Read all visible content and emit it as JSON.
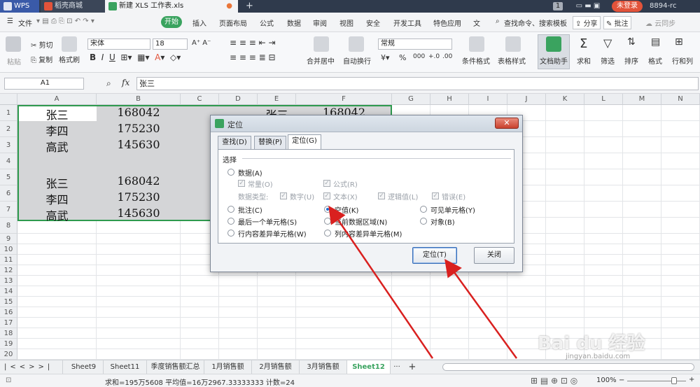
{
  "titlebar": {
    "wps": "WPS",
    "tab_store": "稻壳商城",
    "tab_file": "新建 XLS 工作表.xls",
    "badge": "1",
    "login": "未登录",
    "user_id": "8894-rc"
  },
  "menu": {
    "file": "文件",
    "items": [
      "开始",
      "插入",
      "页面布局",
      "公式",
      "数据",
      "审阅",
      "视图",
      "安全",
      "开发工具",
      "特色应用",
      "文"
    ],
    "search": "查找命令、搜索模板",
    "share": "分享",
    "comment": "批注",
    "cloud": "云同步"
  },
  "ribbon": {
    "paste": "粘贴",
    "cut": "剪切",
    "copy": "复制",
    "format_painter": "格式刷",
    "font_name": "宋体",
    "font_size": "18",
    "merge_center": "合并居中",
    "auto_wrap": "自动换行",
    "number_format": "常规",
    "cond_format": "条件格式",
    "table_style": "表格样式",
    "doc_assistant": "文档助手",
    "sum": "求和",
    "filter": "筛选",
    "sort": "排序",
    "format": "格式",
    "row_col": "行和列",
    "percent": "%",
    "thousands": "000",
    "dec_inc": "+.0",
    "dec_dec": ".00"
  },
  "formula_bar": {
    "name_box": "A1",
    "fx": "fx",
    "value": "张三"
  },
  "grid": {
    "columns": [
      "A",
      "B",
      "C",
      "D",
      "E",
      "F",
      "G",
      "H",
      "I",
      "J",
      "K",
      "L",
      "M",
      "N"
    ],
    "rows": [
      "1",
      "2",
      "3",
      "4",
      "5",
      "6",
      "7",
      "8",
      "9",
      "10",
      "11",
      "12",
      "13",
      "14",
      "15",
      "16",
      "17",
      "18",
      "19",
      "20",
      "21",
      "22",
      "23"
    ],
    "cells": {
      "a1": "张三",
      "b1": "168042",
      "a2": "李四",
      "b2": "175230",
      "a3": "高武",
      "b3": "145630",
      "a6": "张三",
      "b6": "168042",
      "a7": "李四",
      "b7": "175230",
      "a8": "高武",
      "b8": "145630",
      "e1": "张三",
      "f1": "168042"
    }
  },
  "sheets": [
    "Sheet9",
    "Sheet11",
    "季度销售额汇总",
    "1月销售额",
    "2月销售额",
    "3月销售额",
    "Sheet12"
  ],
  "sheet_more": "···",
  "sheet_add": "+",
  "status": {
    "summary": "求和=195万5608  平均值=16万2967.33333333  计数=24",
    "zoom": "100%"
  },
  "dialog": {
    "title": "定位",
    "tabs": [
      "查找(D)",
      "替换(P)",
      "定位(G)"
    ],
    "group_label": "选择",
    "data": "数据(A)",
    "constant": "常量(O)",
    "formula": "公式(R)",
    "data_type": "数据类型:",
    "number": "数字(U)",
    "text": "文本(X)",
    "logical": "逻辑值(L)",
    "error": "错误(E)",
    "comment": "批注(C)",
    "blank": "空值(K)",
    "visible": "可见单元格(Y)",
    "last_cell": "最后一个单元格(S)",
    "current_region": "当前数据区域(N)",
    "object": "对象(B)",
    "row_diff": "行内容差异单元格(W)",
    "col_diff": "列内容差异单元格(M)",
    "ok": "定位(T)",
    "close": "关闭"
  },
  "watermark": {
    "brand": "Bai du 经验",
    "url": "jingyan.baidu.com"
  },
  "colors": {
    "accent": "#3aa35f",
    "arrow": "#d9201f",
    "selection_green": "#2e9a4e"
  }
}
